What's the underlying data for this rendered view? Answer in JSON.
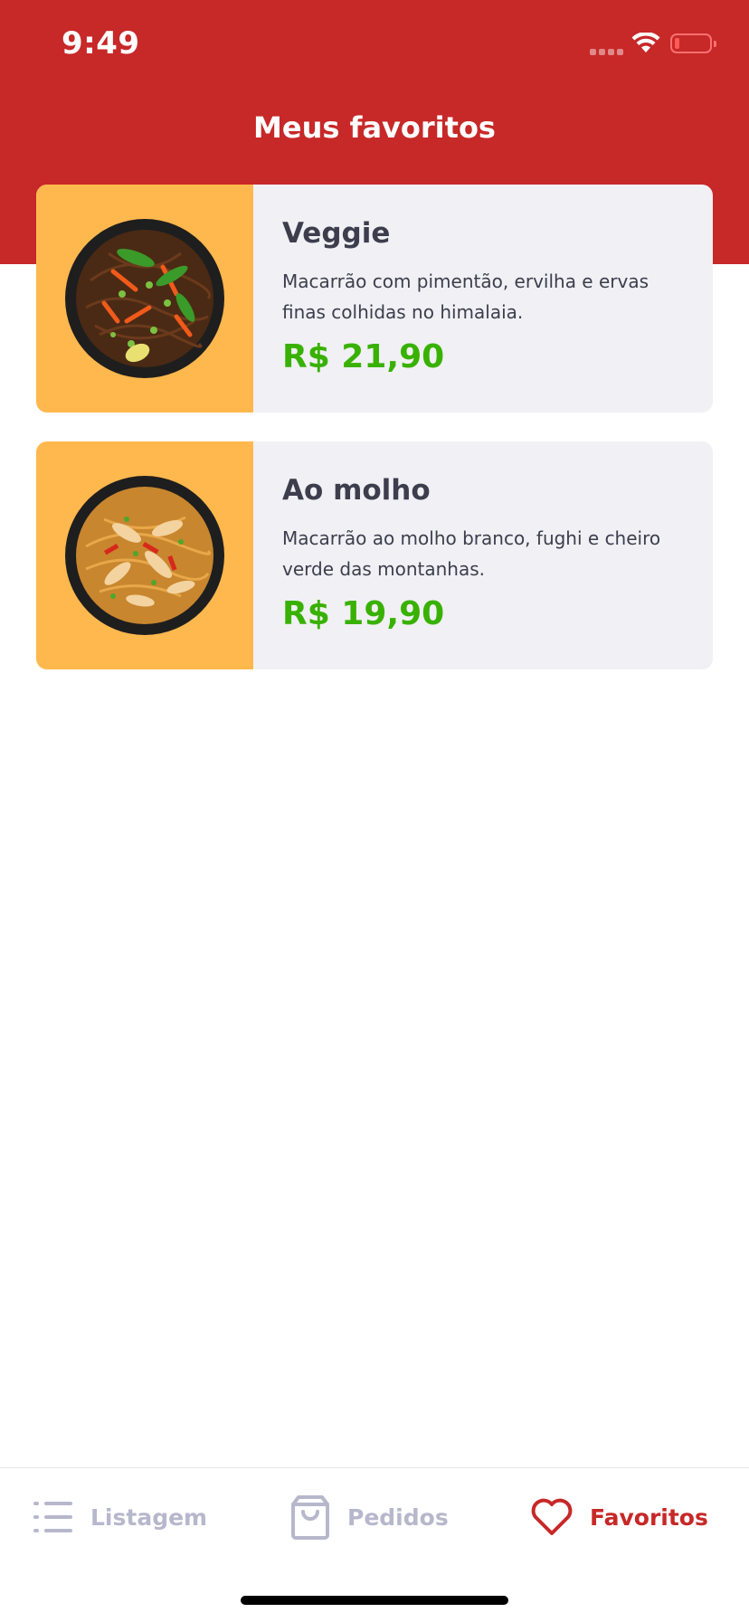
{
  "status_bar": {
    "time": "9:49"
  },
  "header": {
    "title": "Meus favoritos"
  },
  "favorites": [
    {
      "name": "Veggie",
      "description": "Macarrão com pimentão, ervilha e ervas finas colhidas no himalaia.",
      "price": "R$ 21,90",
      "image": "veggie-noodles-bowl"
    },
    {
      "name": "Ao molho",
      "description": "Macarrão ao molho branco, fughi e cheiro verde das montanhas.",
      "price": "R$ 19,90",
      "image": "chicken-noodles-bowl"
    }
  ],
  "tabbar": {
    "tabs": [
      {
        "label": "Listagem",
        "icon": "list-icon",
        "active": false
      },
      {
        "label": "Pedidos",
        "icon": "shopping-bag-icon",
        "active": false
      },
      {
        "label": "Favoritos",
        "icon": "heart-icon",
        "active": true
      }
    ]
  },
  "colors": {
    "primary": "#C72828",
    "card_bg": "#F0F0F5",
    "image_bg": "#FFB84D",
    "price": "#39B100",
    "text": "#3D3D4D",
    "tab_inactive": "#B7B7CC"
  }
}
